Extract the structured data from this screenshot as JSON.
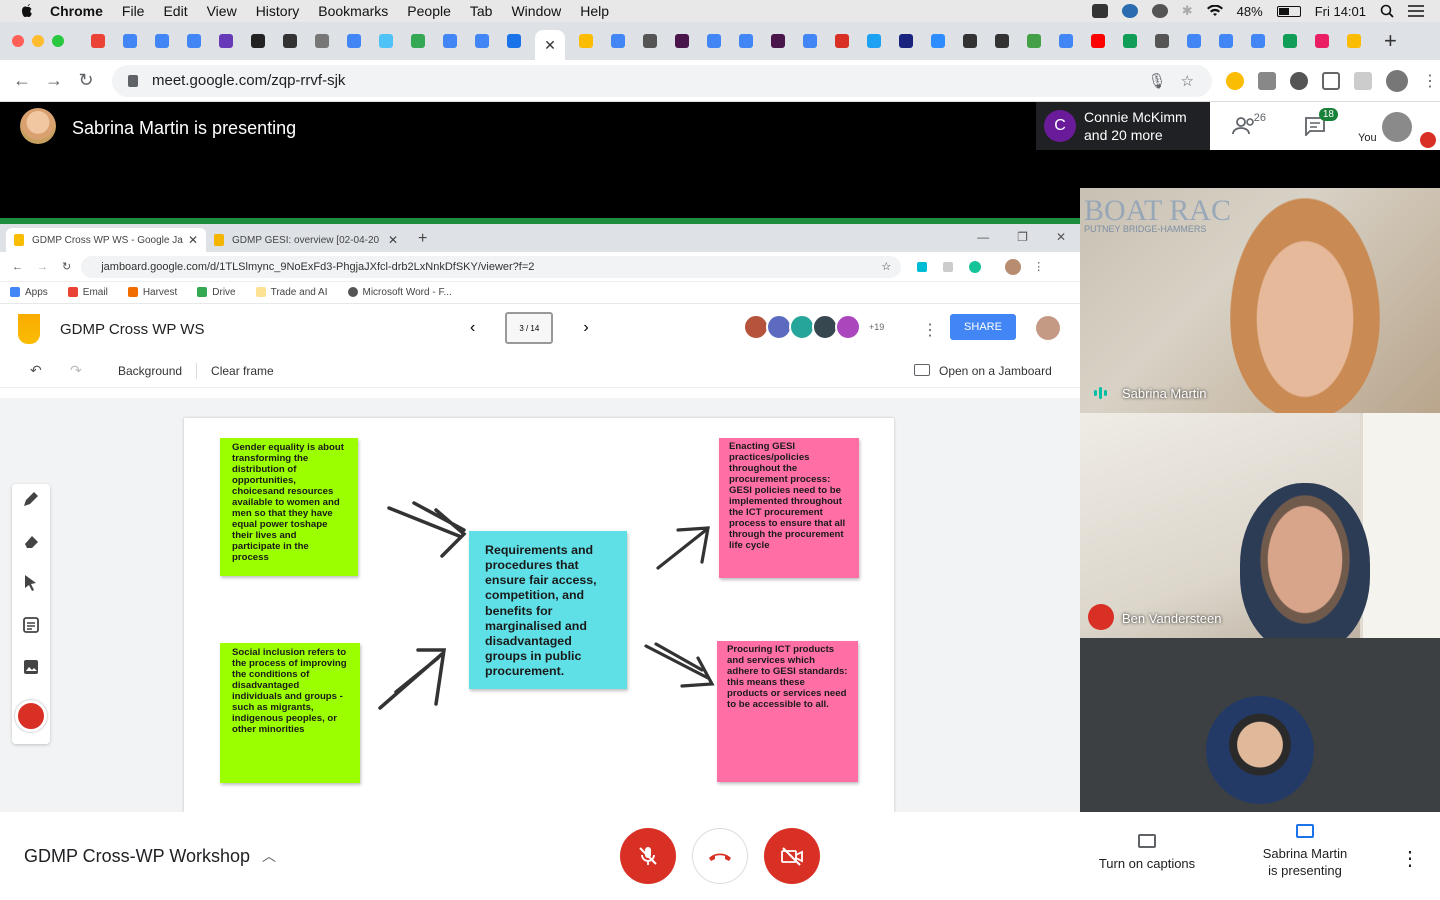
{
  "menubar": {
    "app": "Chrome",
    "items": [
      "File",
      "Edit",
      "View",
      "History",
      "Bookmarks",
      "People",
      "Tab",
      "Window",
      "Help"
    ],
    "battery": "48%",
    "clock": "Fri 14:01"
  },
  "browser": {
    "url": "meet.google.com/zqp-rrvf-sjk"
  },
  "meet": {
    "presenting_banner": "Sabrina Martin is presenting",
    "participant_pill_initial": "C",
    "participant_pill_line1": "Connie McKimm",
    "participant_pill_line2": "and 20 more",
    "people_count": "26",
    "chat_count": "18",
    "you_label": "You",
    "meeting_title": "GDMP Cross-WP Workshop",
    "captions_label": "Turn on captions",
    "presenting_line1": "Sabrina Martin",
    "presenting_line2": "is presenting"
  },
  "tiles": [
    {
      "name": "Sabrina Martin",
      "sign_text": "BOAT RAC",
      "sign_sub": "PUTNEY BRIDGE-HAMMERS"
    },
    {
      "name": "Ben Vandersteen"
    }
  ],
  "shared": {
    "tab1": "GDMP Cross WP WS - Google Ja",
    "tab2": "GDMP GESI: overview [02-04-20",
    "url": "jamboard.google.com/d/1TLSlmync_9NoExFd3-PhgjaJXfcl-drb2LxNnkDfSKY/viewer?f=2",
    "bookmarks": [
      "Apps",
      "Email",
      "Harvest",
      "Drive",
      "Trade and AI",
      "Microsoft Word - F..."
    ],
    "jam_title": "GDMP Cross WP WS",
    "frame_indicator": "3 / 14",
    "collab_more": "+19",
    "share_label": "SHARE",
    "background_label": "Background",
    "clear_label": "Clear frame",
    "open_label": "Open on a Jamboard",
    "notes": {
      "gender": "Gender equality is about transforming the distribution of opportunities, choicesand resources available to women and men so that they have equal power toshape their lives and participate in the process",
      "social": "Social inclusion refers to the process of improving the conditions of disadvantaged individuals and groups - such as migrants, indigenous peoples, or other minorities",
      "center": "Requirements and procedures that ensure fair access, competition, and benefits for marginalised and disadvantaged groups in public procurement.",
      "enacting": "Enacting GESI practices/policies throughout the procurement process: GESI policies need to be implemented throughout the ICT procurement process to ensure that all through the procurement life cycle",
      "procuring": "Procuring ICT products and services which adhere to GESI standards: this means these products or services need to be accessible to all."
    }
  },
  "colors": {
    "note_green": "#9cff00",
    "note_pink": "#ff6fa6",
    "note_cyan": "#5fe0e6",
    "meet_red": "#d93025",
    "accent_blue": "#1a73e8"
  }
}
